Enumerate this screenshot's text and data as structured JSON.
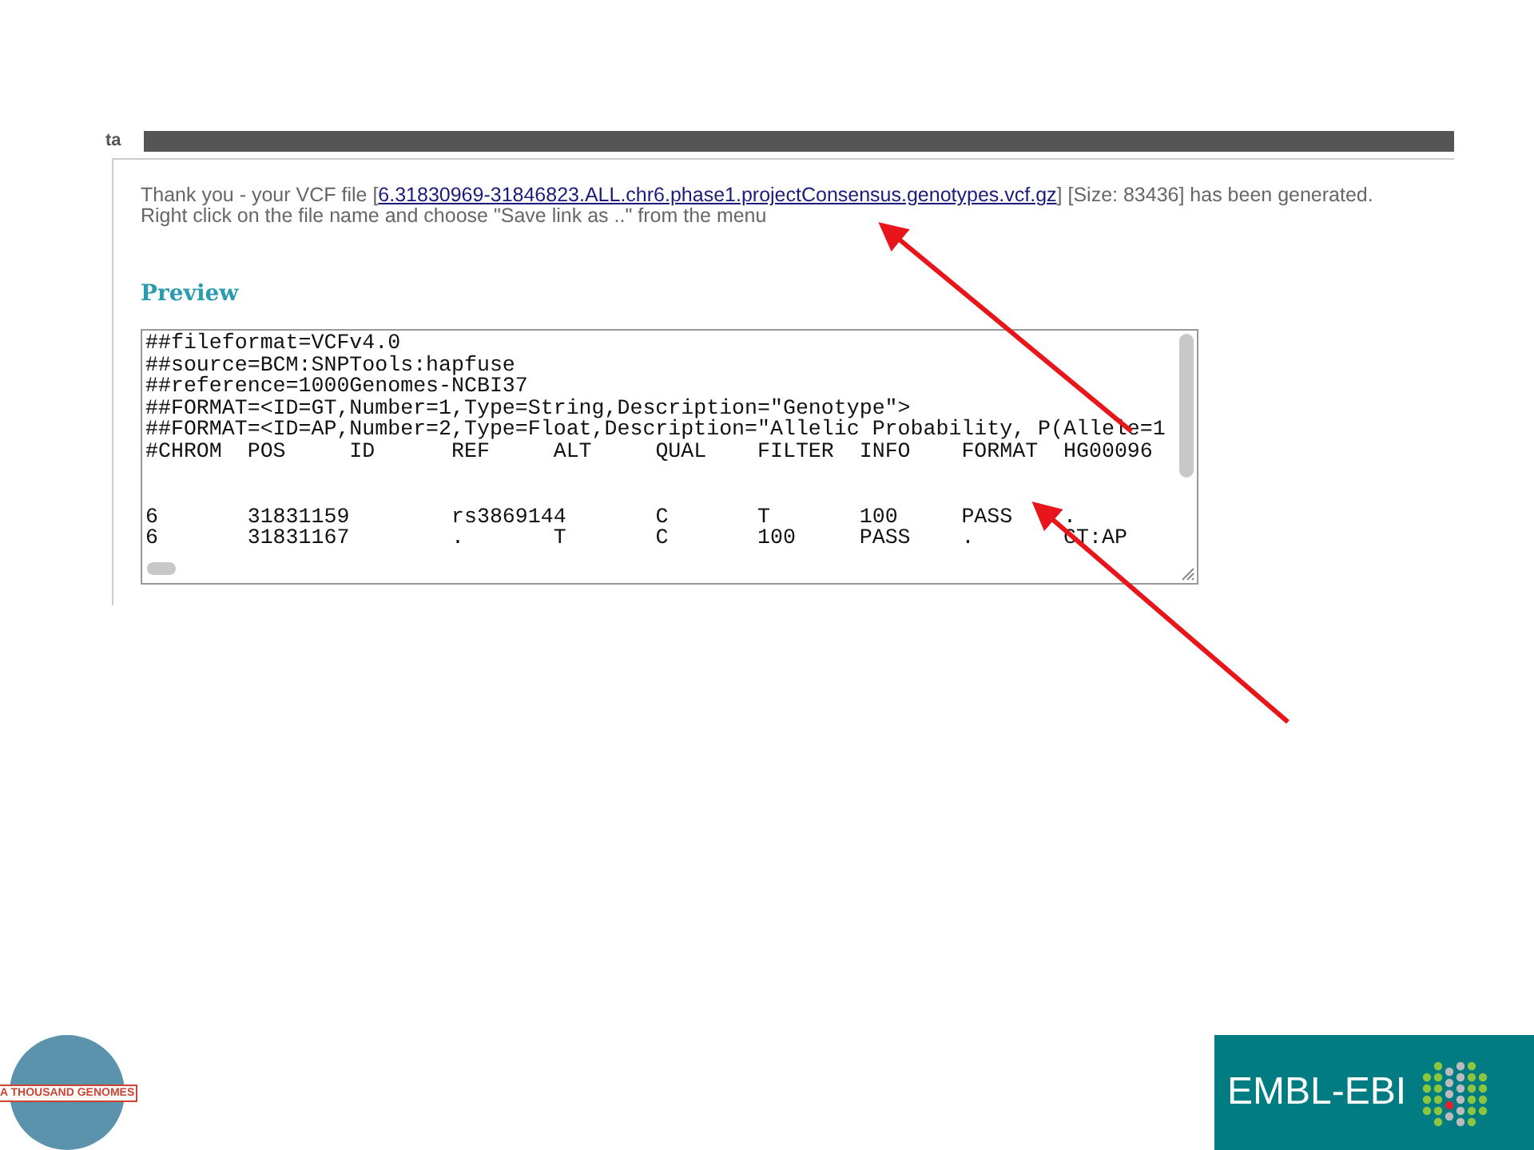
{
  "header": {
    "label": "ta"
  },
  "message": {
    "before": "Thank you - your VCF file [",
    "link": "6.31830969-31846823.ALL.chr6.phase1.projectConsensus.genotypes.vcf.gz",
    "after": "] [Size: 83436] has been generated.",
    "line2": "Right click on the file name and choose \"Save link as ..\" from the menu"
  },
  "preview": {
    "title": "Preview",
    "lines": [
      {
        "kind": "meta",
        "text": "##fileformat=VCFv4.0"
      },
      {
        "kind": "meta",
        "text": "##source=BCM:SNPTools:hapfuse"
      },
      {
        "kind": "meta",
        "text": "##reference=1000Genomes-NCBI37"
      },
      {
        "kind": "meta",
        "text": "##FORMAT=<ID=GT,Number=1,Type=String,Description=\"Genotype\">"
      },
      {
        "kind": "meta",
        "text": "##FORMAT=<ID=AP,Number=2,Type=Float,Description=\"Allelic Probability, P(Allele=1"
      },
      {
        "kind": "header",
        "text": "#CHROM\tPOS\tID\tREF\tALT\tQUAL\tFILTER\tINFO\tFORMAT\tHG00096"
      },
      {
        "kind": "data",
        "text": "6\t31831159\trs3869144\tC\tT\t100\tPASS\t."
      },
      {
        "kind": "data",
        "text": "6\t31831167\t.\tT\tC\t100\tPASS\t.\tGT:AP"
      }
    ]
  },
  "footer": {
    "left_logo": "A THOUSAND GENOMES",
    "right_logo": "EMBL-EBI"
  }
}
